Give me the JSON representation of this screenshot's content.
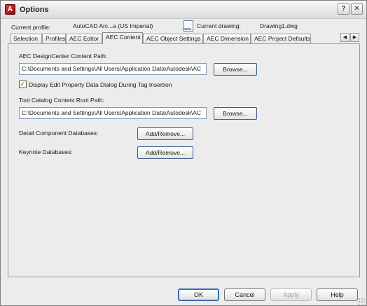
{
  "window": {
    "title": "Options",
    "icon": "autocad-app-icon",
    "help_glyph": "?",
    "close_glyph": "✕"
  },
  "profile": {
    "current_profile_label": "Current profile:",
    "current_profile_value": "AutoCAD Arc...a (US Imperial)",
    "current_drawing_label": "Current drawing:",
    "current_drawing_value": "Drawing1.dwg"
  },
  "tabs": [
    {
      "label": "Selection",
      "active": false
    },
    {
      "label": "Profiles",
      "active": false
    },
    {
      "label": "AEC Editor",
      "active": false
    },
    {
      "label": "AEC Content",
      "active": true
    },
    {
      "label": "AEC Object Settings",
      "active": false
    },
    {
      "label": "AEC Dimension",
      "active": false
    },
    {
      "label": "AEC Project Defaults",
      "active": false
    }
  ],
  "tab_scroll": {
    "left_glyph": "◀",
    "right_glyph": "▶"
  },
  "content": {
    "designcenter_path_label": "AEC DesignCenter Content Path:",
    "designcenter_path_value": "C:\\Documents and Settings\\All Users\\Application Data\\Autodesk\\AC",
    "browse_label": "Browse...",
    "display_edit_checkbox_label": "Display Edit Property Data Dialog During Tag Insertion",
    "display_edit_checked": true,
    "tool_catalog_label": "Tool Catalog Content Root Path:",
    "tool_catalog_value": "C:\\Documents and Settings\\All Users\\Application Data\\Autodesk\\AC",
    "detail_db_label": "Detail Component Databases:",
    "keynote_db_label": "Keynote Databases:",
    "add_remove_label": "Add/Remove..."
  },
  "footer": {
    "ok": "OK",
    "cancel": "Cancel",
    "apply": "Apply",
    "help": "Help"
  },
  "colors": {
    "dialog_bg": "#ececec",
    "field_border": "#7f9db9",
    "default_button_border": "#3a6ea8",
    "disabled_text": "#a0a0a0"
  }
}
